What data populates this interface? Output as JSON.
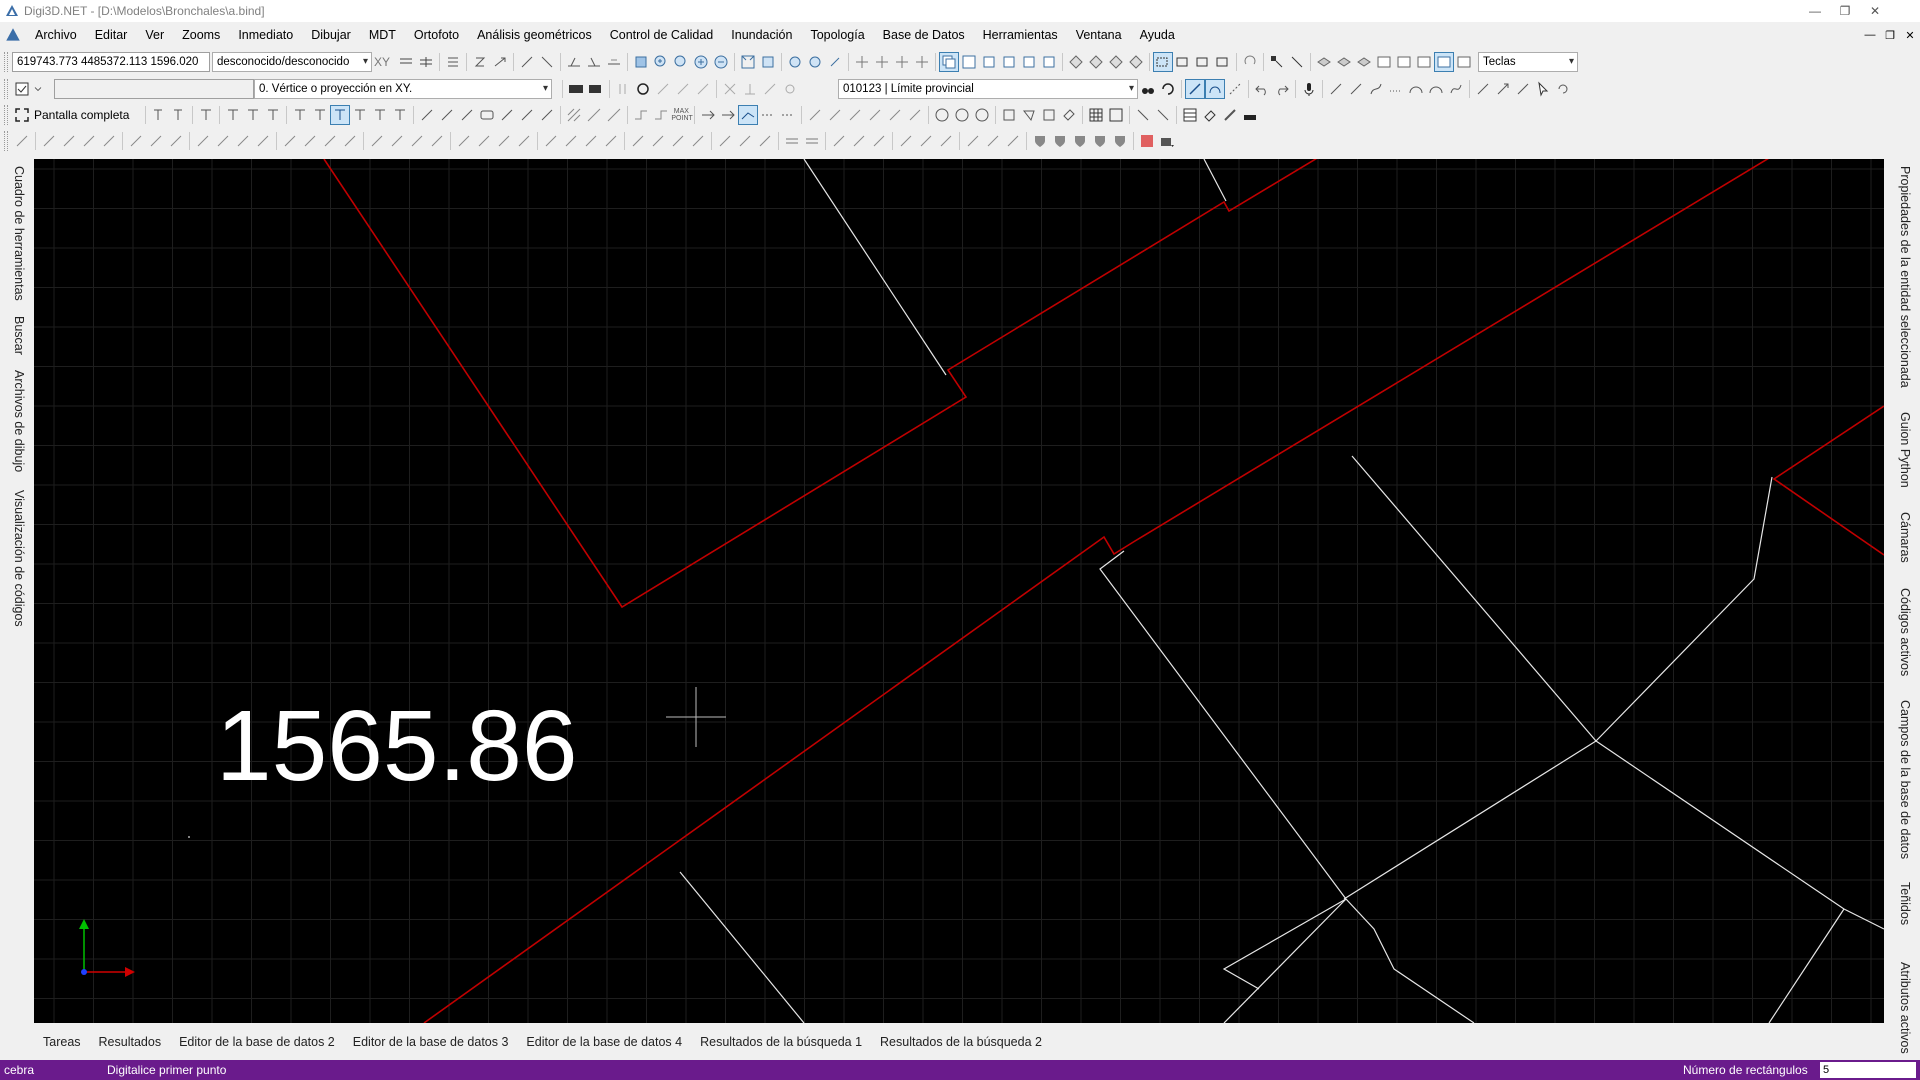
{
  "window": {
    "title": "Digi3D.NET - [D:\\Modelos\\Bronchales\\a.bind]"
  },
  "menu": [
    "Archivo",
    "Editar",
    "Ver",
    "Zooms",
    "Inmediato",
    "Dibujar",
    "MDT",
    "Ortofoto",
    "Análisis geométricos",
    "Control de Calidad",
    "Inundación",
    "Topología",
    "Base de Datos",
    "Herramientas",
    "Ventana",
    "Ayuda"
  ],
  "toolbar": {
    "coordinates": "619743.773 4485372.113 1596.020",
    "crs": "desconocido/desconocido",
    "xy_label": "XY",
    "snap_mode": "0. Vértice o proyección en XY.",
    "code": "010123 | Límite provincial",
    "keys_combo": "Teclas",
    "fullscreen_label": "Pantalla completa",
    "max_point": "MAX POINT"
  },
  "left_tabs": [
    "Cuadro de herramientas",
    "Buscar",
    "Archivos de dibujo",
    "Visualización de códigos"
  ],
  "right_tabs": [
    "Propiedades de la entidad seleccionada",
    "Guion Python",
    "Cámaras",
    "Códigos activos",
    "Campos de la base de datos",
    "Teñidos",
    "Atributos activos"
  ],
  "viewport": {
    "elevation_label": "1565.86",
    "background": "#000000",
    "grid_color": "#1e1e1e",
    "boundary_color": "#c00000",
    "line_color": "#e6e6e6"
  },
  "bottom_tabs": [
    "Tareas",
    "Resultados",
    "Editor de la base de datos 2",
    "Editor de la base de datos 3",
    "Editor de la base de datos 4",
    "Resultados de la búsqueda 1",
    "Resultados de la búsqueda 2"
  ],
  "status": {
    "mode": "cebra",
    "message": "Digitalice primer punto",
    "rect_label": "Número de rectángulos",
    "rect_value": "5"
  },
  "colors": {
    "statusbar": "#6a1b8c",
    "chrome": "#f0f0f0"
  }
}
